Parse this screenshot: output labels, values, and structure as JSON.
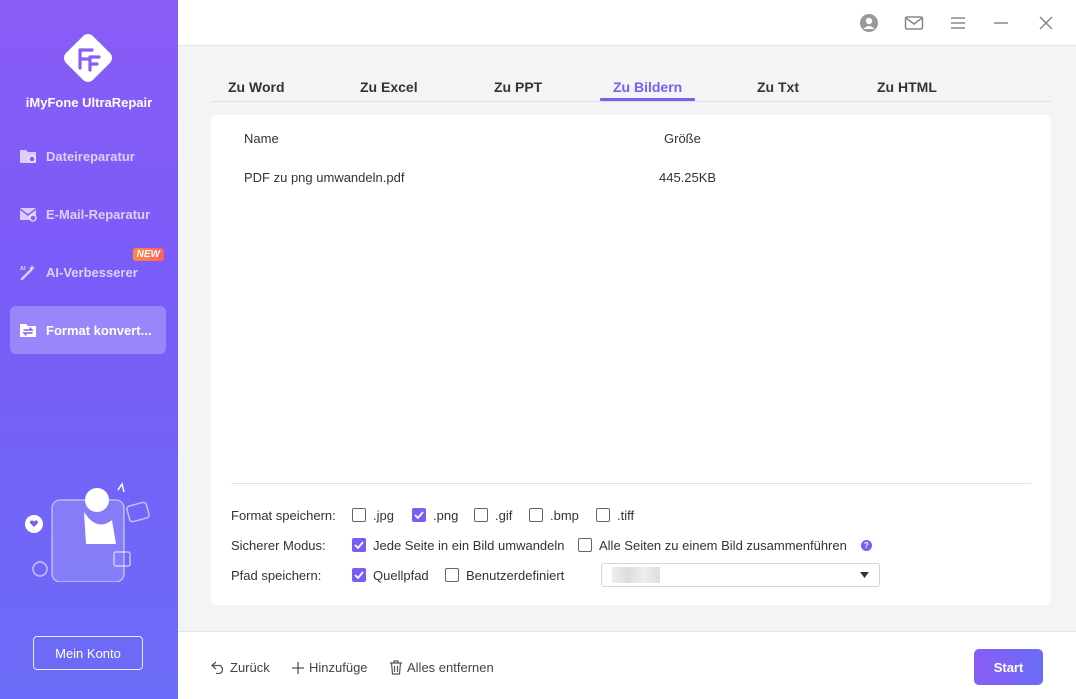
{
  "app": {
    "name": "iMyFone UltraRepair"
  },
  "sidebar": {
    "items": [
      {
        "label": "Dateireparatur",
        "icon": "file-repair-icon",
        "active": false
      },
      {
        "label": "E-Mail-Reparatur",
        "icon": "email-repair-icon",
        "active": false
      },
      {
        "label": "AI-Verbesserer",
        "icon": "ai-enhance-icon",
        "active": false,
        "badge": "NEW"
      },
      {
        "label": "Format konvert...",
        "icon": "format-convert-icon",
        "active": true
      }
    ],
    "account_button": "Mein Konto"
  },
  "tabs": [
    {
      "label": "Zu Word"
    },
    {
      "label": "Zu Excel"
    },
    {
      "label": "Zu PPT"
    },
    {
      "label": "Zu Bildern",
      "active": true
    },
    {
      "label": "Zu Txt"
    },
    {
      "label": "Zu HTML"
    }
  ],
  "table": {
    "headers": {
      "name": "Name",
      "size": "Größe"
    },
    "rows": [
      {
        "name": "PDF zu png umwandeln.pdf",
        "size": "445.25KB"
      }
    ]
  },
  "options": {
    "format": {
      "label": "Format speichern:",
      "choices": [
        {
          "label": ".jpg",
          "checked": false
        },
        {
          "label": ".png",
          "checked": true
        },
        {
          "label": ".gif",
          "checked": false
        },
        {
          "label": ".bmp",
          "checked": false
        },
        {
          "label": ".tiff",
          "checked": false
        }
      ]
    },
    "mode": {
      "label": "Sicherer Modus:",
      "choices": [
        {
          "label": "Jede Seite in ein Bild umwandeln",
          "checked": true
        },
        {
          "label": "Alle Seiten zu einem Bild zusammenführen",
          "checked": false
        }
      ]
    },
    "path": {
      "label": "Pfad speichern:",
      "choices": [
        {
          "label": "Quellpfad",
          "checked": true
        },
        {
          "label": "Benutzerdefiniert",
          "checked": false
        }
      ]
    }
  },
  "bottom": {
    "back": "Zurück",
    "add": "Hinzufüge",
    "remove_all": "Alles entfernen",
    "start": "Start"
  },
  "colors": {
    "accent": "#7b5cf5",
    "sidebar_top": "#8a5cf6",
    "sidebar_bottom": "#6b6cf7"
  }
}
